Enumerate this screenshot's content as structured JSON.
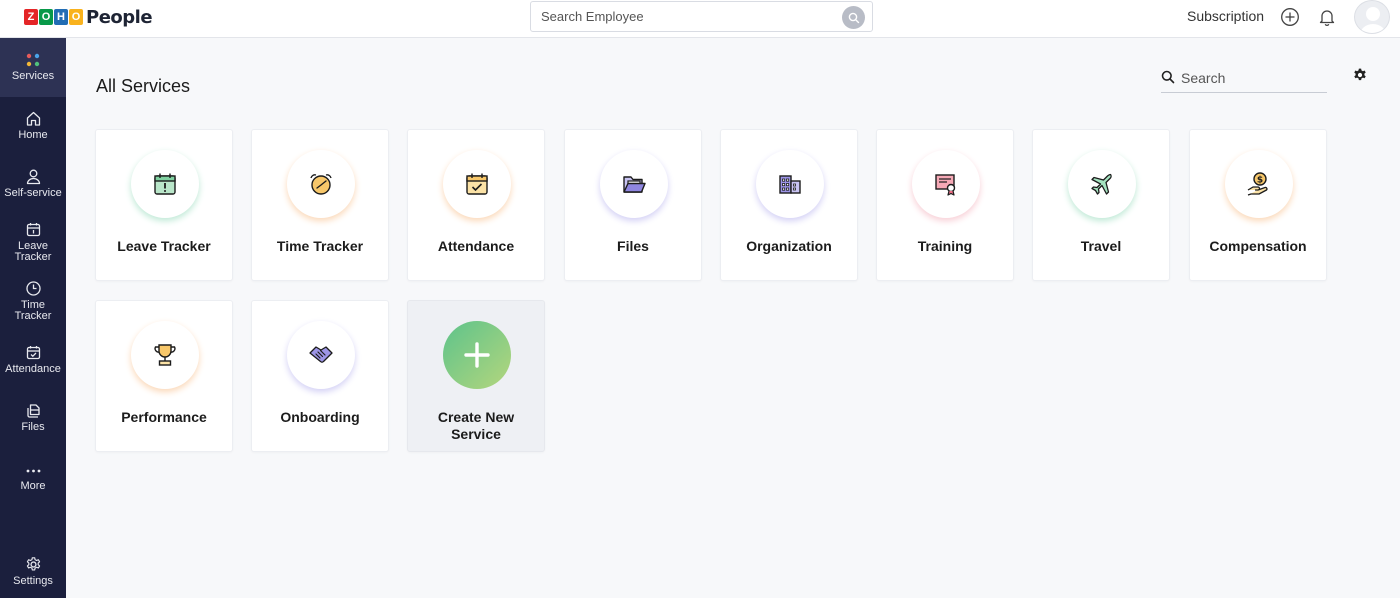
{
  "header": {
    "logo_letters": [
      "Z",
      "O",
      "H",
      "O"
    ],
    "logo_colors": [
      "#e42527",
      "#089949",
      "#226db4",
      "#f9b21d"
    ],
    "app_name": "People",
    "search_placeholder": "Search Employee",
    "subscription_label": "Subscription"
  },
  "sidebar": {
    "items": [
      {
        "label": "Services",
        "icon": "services-dots-icon",
        "active": true
      },
      {
        "label": "Home",
        "icon": "home-icon"
      },
      {
        "label": "Self-service",
        "icon": "person-icon"
      },
      {
        "label": "Leave\nTracker",
        "icon": "calendar-icon"
      },
      {
        "label": "Time\nTracker",
        "icon": "clock-icon"
      },
      {
        "label": "Attendance",
        "icon": "calendar-check-icon"
      },
      {
        "label": "Files",
        "icon": "files-icon"
      },
      {
        "label": "More",
        "icon": "more-dots-icon"
      },
      {
        "label": "Settings",
        "icon": "gear-icon"
      }
    ]
  },
  "main": {
    "title": "All Services",
    "search_placeholder": "Search",
    "services": [
      {
        "label": "Leave Tracker",
        "icon": "leave-calendar-icon",
        "glow": "#bfe9d6"
      },
      {
        "label": "Time Tracker",
        "icon": "alarm-clock-icon",
        "glow": "#fbd8b8"
      },
      {
        "label": "Attendance",
        "icon": "attendance-calendar-icon",
        "glow": "#fbd8b8"
      },
      {
        "label": "Files",
        "icon": "folder-icon",
        "glow": "#d3d0f5"
      },
      {
        "label": "Organization",
        "icon": "building-icon",
        "glow": "#d3d0f5"
      },
      {
        "label": "Training",
        "icon": "certificate-icon",
        "glow": "#f8cfd6"
      },
      {
        "label": "Travel",
        "icon": "airplane-icon",
        "glow": "#bfe9d6"
      },
      {
        "label": "Compensation",
        "icon": "money-hand-icon",
        "glow": "#fbd8b8"
      },
      {
        "label": "Performance",
        "icon": "trophy-icon",
        "glow": "#fbd8b8"
      },
      {
        "label": "Onboarding",
        "icon": "handshake-icon",
        "glow": "#d3d0f5"
      }
    ],
    "create_label": "Create New Service"
  }
}
